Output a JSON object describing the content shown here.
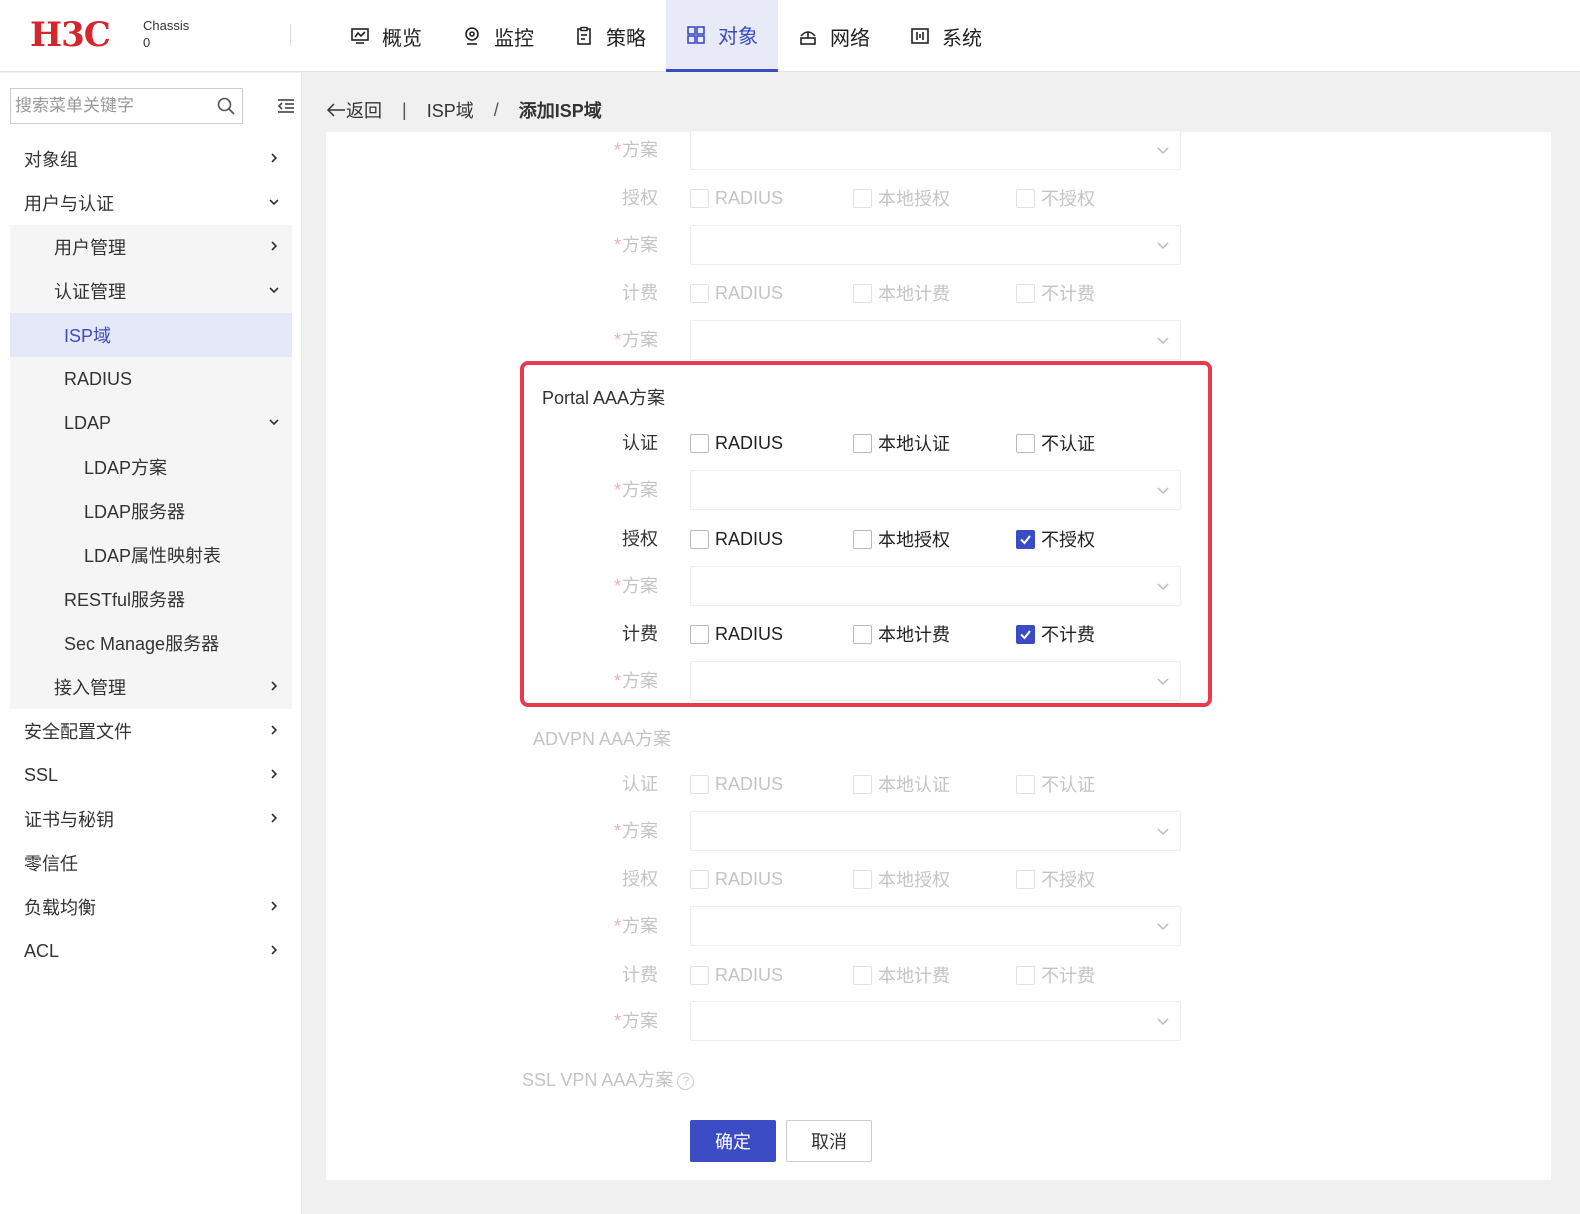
{
  "header": {
    "logo": "H3C",
    "device_line1": "Chassis",
    "device_line2": "0",
    "tabs": [
      {
        "label": "概览",
        "icon": "monitor-icon"
      },
      {
        "label": "监控",
        "icon": "location-icon"
      },
      {
        "label": "策略",
        "icon": "clipboard-icon"
      },
      {
        "label": "对象",
        "icon": "grid-icon",
        "active": true
      },
      {
        "label": "网络",
        "icon": "network-icon"
      },
      {
        "label": "系统",
        "icon": "system-icon"
      }
    ]
  },
  "sidebar": {
    "search_placeholder": "搜索菜单关键字",
    "items": [
      {
        "label": "对象组"
      },
      {
        "label": "用户与认证"
      },
      {
        "label": "用户管理"
      },
      {
        "label": "认证管理"
      },
      {
        "label": "ISP域"
      },
      {
        "label": "RADIUS"
      },
      {
        "label": "LDAP"
      },
      {
        "label": "LDAP方案"
      },
      {
        "label": "LDAP服务器"
      },
      {
        "label": "LDAP属性映射表"
      },
      {
        "label": "RESTful服务器"
      },
      {
        "label": "Sec Manage服务器"
      },
      {
        "label": "接入管理"
      },
      {
        "label": "安全配置文件"
      },
      {
        "label": "SSL"
      },
      {
        "label": "证书与秘钥"
      },
      {
        "label": "零信任"
      },
      {
        "label": "负载均衡"
      },
      {
        "label": "ACL"
      }
    ]
  },
  "breadcrumb": {
    "back": "返回",
    "sep1": "|",
    "parent": "ISP域",
    "sep2": "/",
    "current": "添加ISP域"
  },
  "form": {
    "scheme_label": "方案",
    "required_mark": "*",
    "auth_label": "认证",
    "authz_label": "授权",
    "acct_label": "计费",
    "opt_radius": "RADIUS",
    "opt_local_auth": "本地认证",
    "opt_no_auth": "不认证",
    "opt_local_authz": "本地授权",
    "opt_no_authz": "不授权",
    "opt_local_acct": "本地计费",
    "opt_no_acct": "不计费",
    "portal_title": "Portal AAA方案",
    "advpn_title": "ADVPN AAA方案",
    "sslvpn_title": "SSL VPN AAA方案",
    "help_glyph": "?",
    "portal": {
      "auth": {
        "radius": false,
        "local": false,
        "none": false
      },
      "authz": {
        "radius": false,
        "local": false,
        "none": true
      },
      "acct": {
        "radius": false,
        "local": false,
        "none": true
      }
    },
    "ok_label": "确定",
    "cancel_label": "取消"
  },
  "colors": {
    "brand_red": "#d5262c",
    "accent_blue": "#3b4bc4",
    "highlight_border": "#e63c4e"
  }
}
